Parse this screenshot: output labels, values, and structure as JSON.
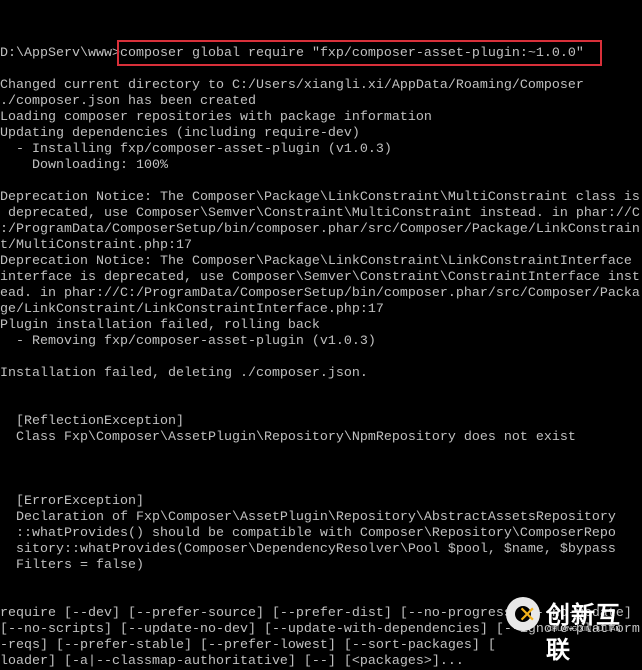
{
  "prompt": "D:\\AppServ\\www>",
  "command": "composer global require \"fxp/composer-asset-plugin:~1.0.0\"",
  "highlight_color": "#d9303a",
  "text_color": "#c0c0c0",
  "lines": [
    "",
    "Changed current directory to C:/Users/xiangli.xi/AppData/Roaming/Composer",
    "./composer.json has been created",
    "Loading composer repositories with package information",
    "Updating dependencies (including require-dev)",
    "  - Installing fxp/composer-asset-plugin (v1.0.3)",
    "    Downloading: 100%",
    "",
    "Deprecation Notice: The Composer\\Package\\LinkConstraint\\MultiConstraint class is",
    " deprecated, use Composer\\Semver\\Constraint\\MultiConstraint instead. in phar://C",
    ":/ProgramData/ComposerSetup/bin/composer.phar/src/Composer/Package/LinkConstrain",
    "t/MultiConstraint.php:17",
    "Deprecation Notice: The Composer\\Package\\LinkConstraint\\LinkConstraintInterface",
    "interface is deprecated, use Composer\\Semver\\Constraint\\ConstraintInterface inst",
    "ead. in phar://C:/ProgramData/ComposerSetup/bin/composer.phar/src/Composer/Packa",
    "ge/LinkConstraint/LinkConstraintInterface.php:17",
    "Plugin installation failed, rolling back",
    "  - Removing fxp/composer-asset-plugin (v1.0.3)",
    "",
    "Installation failed, deleting ./composer.json.",
    "",
    "",
    "  [ReflectionException]",
    "  Class Fxp\\Composer\\AssetPlugin\\Repository\\NpmRepository does not exist",
    "",
    "",
    "",
    "  [ErrorException]",
    "  Declaration of Fxp\\Composer\\AssetPlugin\\Repository\\AbstractAssetsRepository",
    "  ::whatProvides() should be compatible with Composer\\Repository\\ComposerRepo",
    "  sitory::whatProvides(Composer\\DependencyResolver\\Pool $pool, $name, $bypass",
    "  Filters = false)",
    "",
    "",
    "require [--dev] [--prefer-source] [--prefer-dist] [--no-progress] [--no-update]",
    "[--no-scripts] [--update-no-dev] [--update-with-dependencies] [--ignore-platform",
    "-reqs] [--prefer-stable] [--prefer-lowest] [--sort-packages] [",
    "loader] [-a|--classmap-authoritative] [--] [<packages>]..."
  ],
  "watermark": {
    "brand_cn": "创新互联",
    "brand_en": "CHUANG XIN HU LIAN",
    "accent": "#f2b21b"
  }
}
